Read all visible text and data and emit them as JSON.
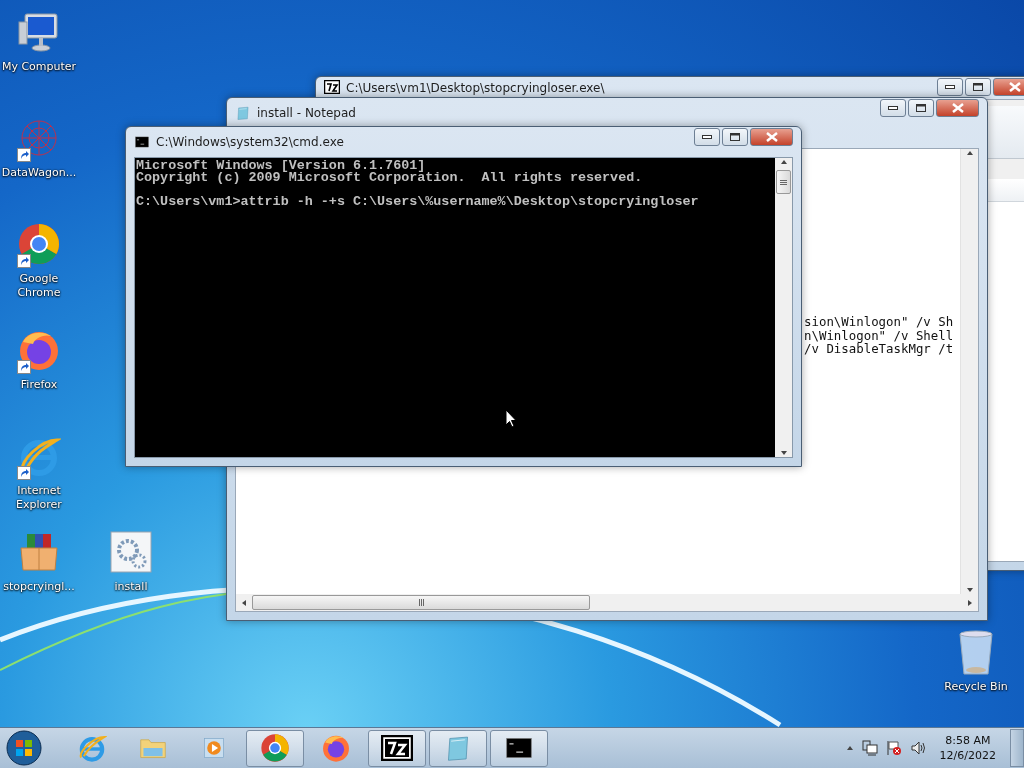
{
  "desktop_icons": [
    {
      "kind": "computer",
      "label": "My Computer",
      "shortcut": false
    },
    {
      "kind": "web",
      "label": "DataWagon...",
      "shortcut": true
    },
    {
      "kind": "chrome",
      "label": "Google Chrome",
      "shortcut": true
    },
    {
      "kind": "firefox",
      "label": "Firefox",
      "shortcut": true
    },
    {
      "kind": "ie",
      "label": "Internet Explorer",
      "shortcut": true
    }
  ],
  "desktop_icons_row": [
    {
      "kind": "archive",
      "label": "stopcryingl...",
      "shortcut": false
    },
    {
      "kind": "script",
      "label": "install",
      "shortcut": false
    }
  ],
  "recycle_bin": {
    "label": "Recycle Bin"
  },
  "windows": [
    {
      "kind": "archive",
      "title": "C:\\Users\\vm1\\Desktop\\stopcryingloser.exe\\"
    },
    {
      "kind": "notepad",
      "title": "install - Notepad",
      "lines": [
        "sion\\Winlogon\" /v Sh",
        "n\\Winlogon\" /v Shell",
        "/v DisableTaskMgr /t"
      ]
    },
    {
      "kind": "console",
      "title": "C:\\Windows\\system32\\cmd.exe",
      "banner": [
        "Microsoft Windows [Version 6.1.7601]",
        "Copyright (c) 2009 Microsoft Corporation.  All rights reserved."
      ],
      "command": "C:\\Users\\vm1>attrib -h -+s C:\\Users\\%username%\\Desktop\\stopcryingloser"
    }
  ],
  "taskbar": {
    "items": [
      {
        "kind": "ie",
        "open": false
      },
      {
        "kind": "explorer",
        "open": false
      },
      {
        "kind": "media",
        "open": false
      },
      {
        "kind": "chrome",
        "open": true
      },
      {
        "kind": "firefox",
        "open": false
      },
      {
        "kind": "archive",
        "open": true
      },
      {
        "kind": "notepad",
        "open": true
      },
      {
        "kind": "console",
        "open": true
      }
    ],
    "time": "8:58 AM",
    "date": "12/6/2022"
  }
}
